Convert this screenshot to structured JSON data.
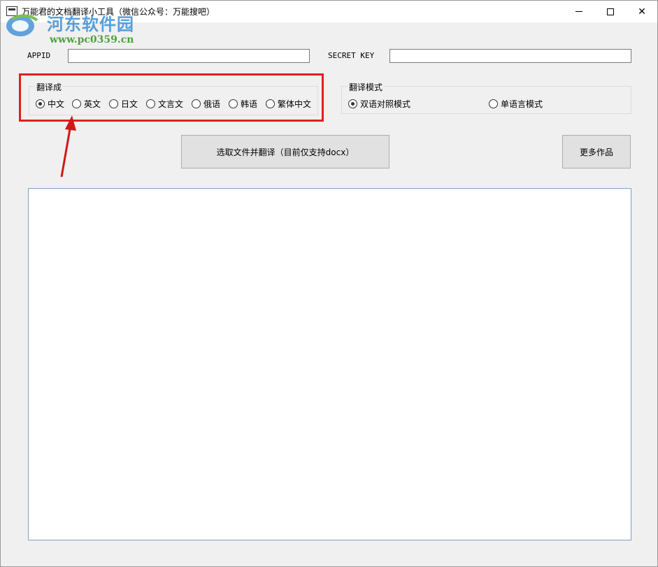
{
  "window": {
    "title": "万能君的文档翻译小工具（微信公众号：万能搜吧）",
    "controls": {
      "minimize": "minimize",
      "maximize": "maximize",
      "close": "✕"
    }
  },
  "watermark": {
    "title": "河东软件园",
    "url": "www.pc0359.cn"
  },
  "credentials": {
    "appid_label": "APPID",
    "appid_value": "",
    "secret_label": "SECRET KEY",
    "secret_value": ""
  },
  "target_language": {
    "group_title": "翻译成",
    "options": [
      "中文",
      "英文",
      "日文",
      "文言文",
      "俄语",
      "韩语",
      "繁体中文"
    ],
    "selected": "中文"
  },
  "translation_mode": {
    "group_title": "翻译模式",
    "options": [
      "双语对照模式",
      "单语言模式"
    ],
    "selected": "双语对照模式"
  },
  "actions": {
    "select_file_label": "选取文件并翻译（目前仅支持docx）",
    "more_works_label": "更多作品"
  },
  "output": {
    "text": ""
  },
  "colors": {
    "highlight_border": "#e02020",
    "watermark_blue": "#3c8fd6",
    "watermark_green": "#4aa43a"
  }
}
